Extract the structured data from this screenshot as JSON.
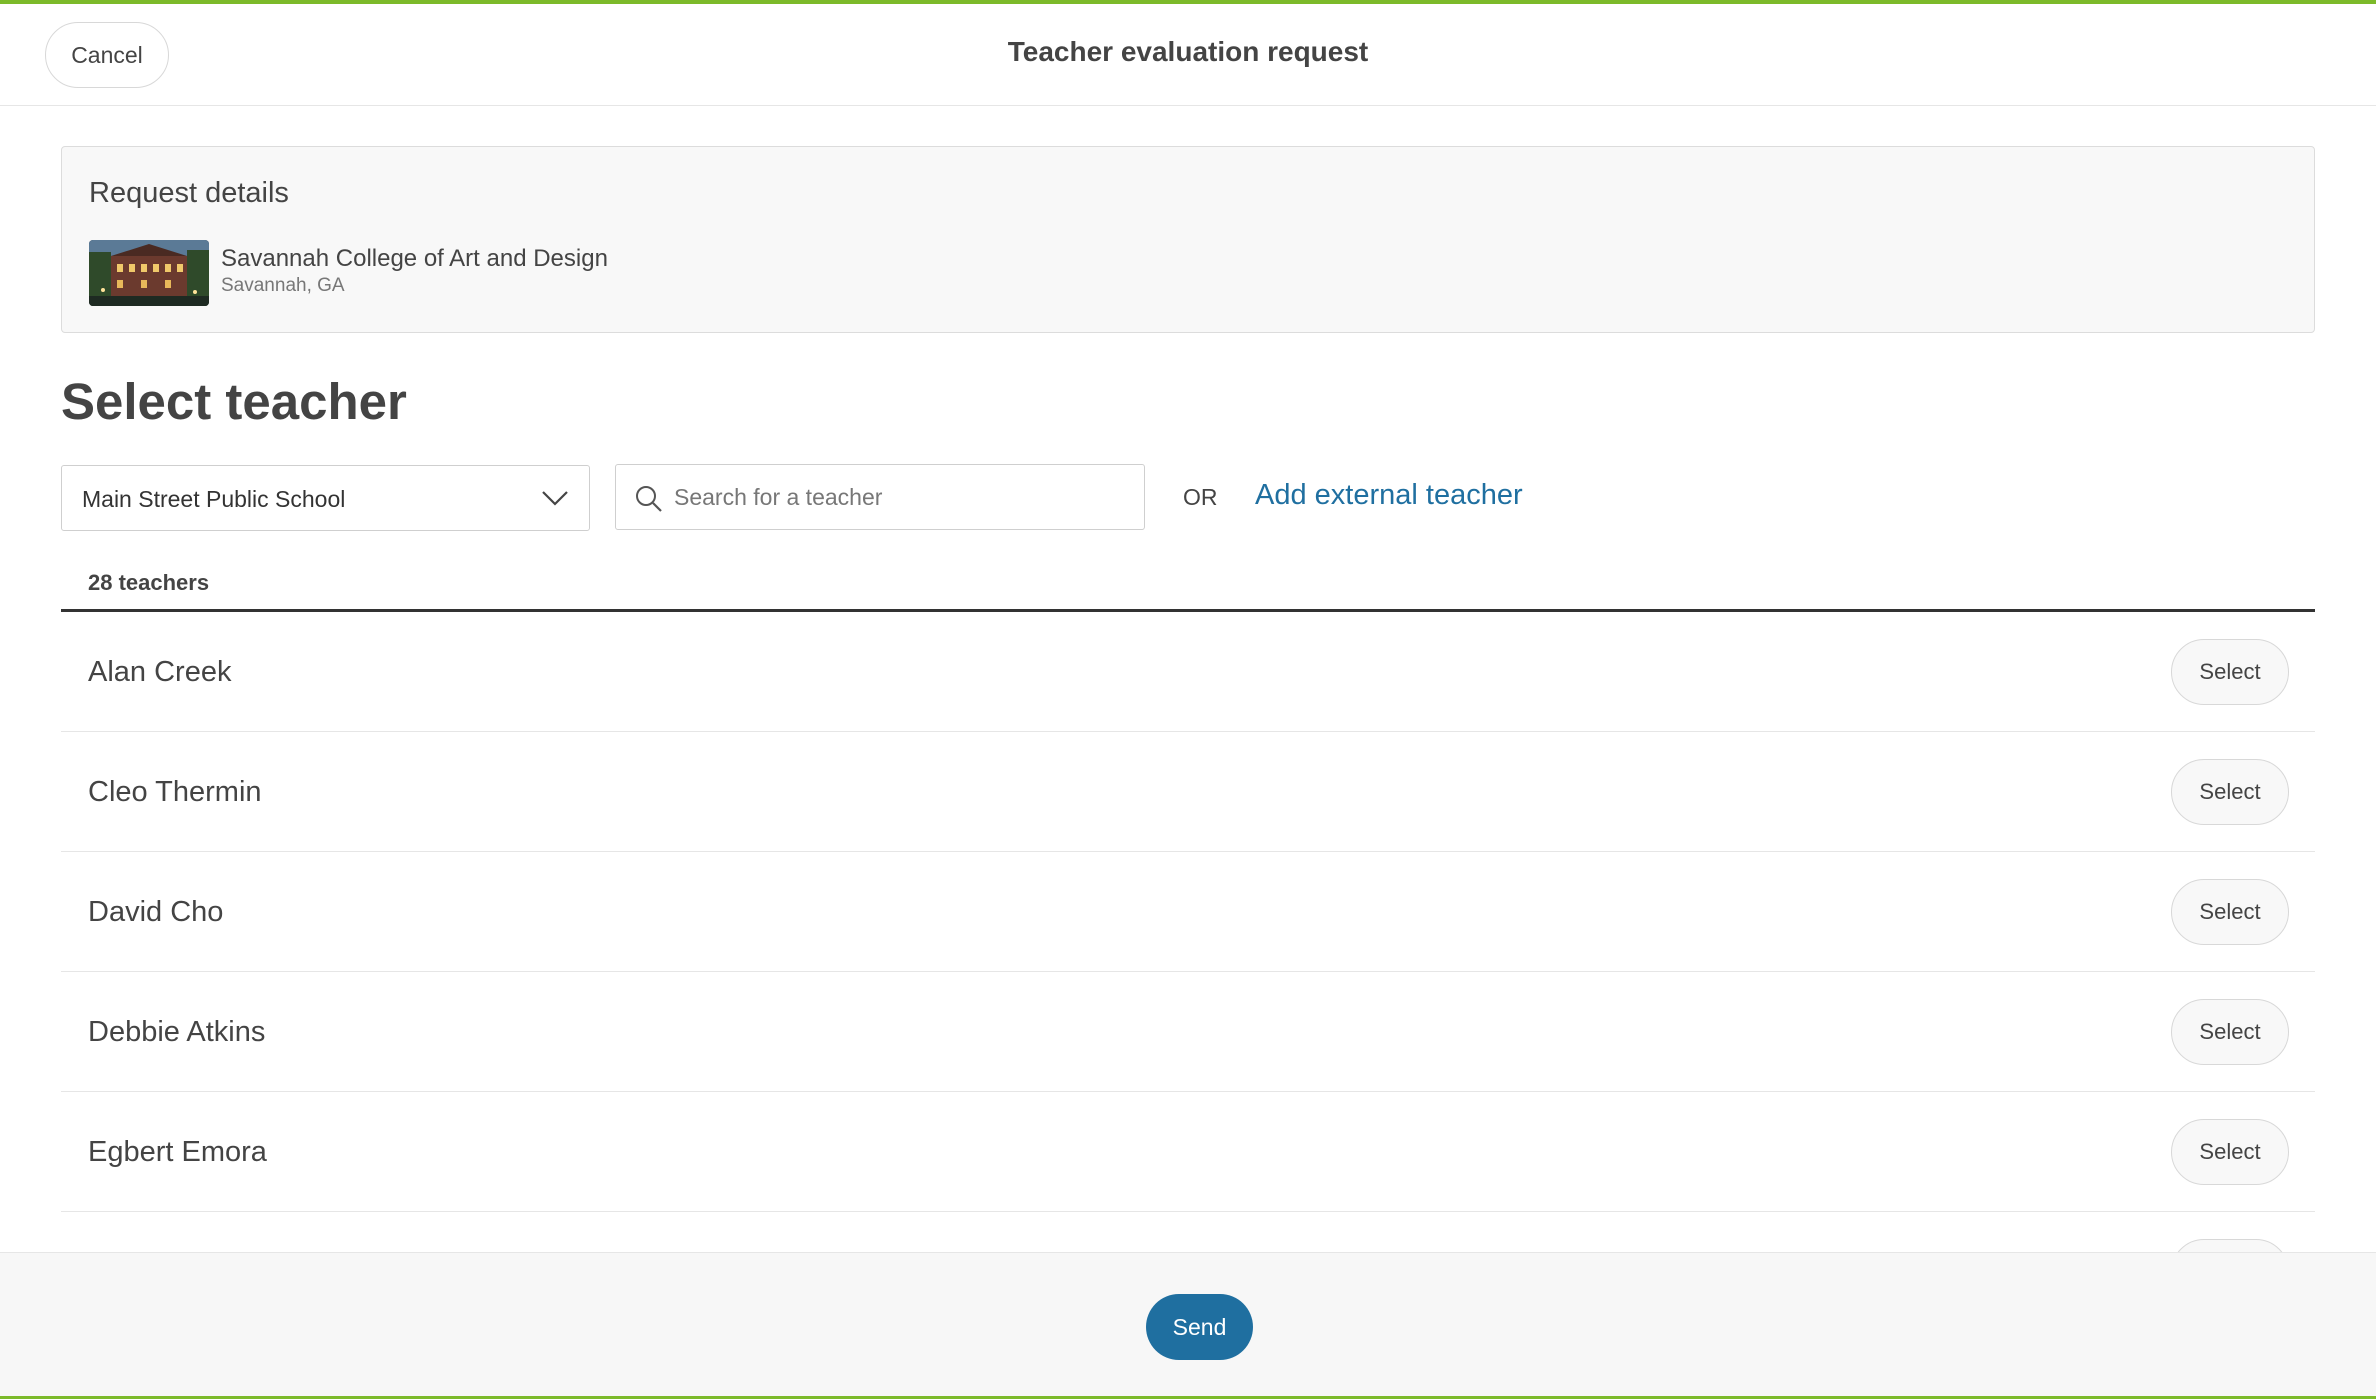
{
  "header": {
    "cancel_label": "Cancel",
    "title": "Teacher evaluation request"
  },
  "request_details": {
    "title": "Request details",
    "school_name": "Savannah College of Art and Design",
    "school_location": "Savannah, GA"
  },
  "select_teacher": {
    "title": "Select teacher",
    "school_dropdown_value": "Main Street Public School",
    "search_placeholder": "Search for a teacher",
    "search_value": "",
    "or_label": "OR",
    "add_external_label": "Add external teacher",
    "count_label": "28 teachers"
  },
  "teachers": [
    {
      "name": "Alan Creek",
      "select_label": "Select"
    },
    {
      "name": "Cleo Thermin",
      "select_label": "Select"
    },
    {
      "name": "David Cho",
      "select_label": "Select"
    },
    {
      "name": "Debbie Atkins",
      "select_label": "Select"
    },
    {
      "name": "Egbert Emora",
      "select_label": "Select"
    },
    {
      "name": "",
      "select_label": ""
    }
  ],
  "footer": {
    "send_label": "Send"
  },
  "colors": {
    "accent_blue": "#1f6fa0",
    "top_bar_green": "#7cba2a"
  },
  "icons": [
    "chevron-down-icon",
    "search-icon",
    "school-thumbnail"
  ]
}
